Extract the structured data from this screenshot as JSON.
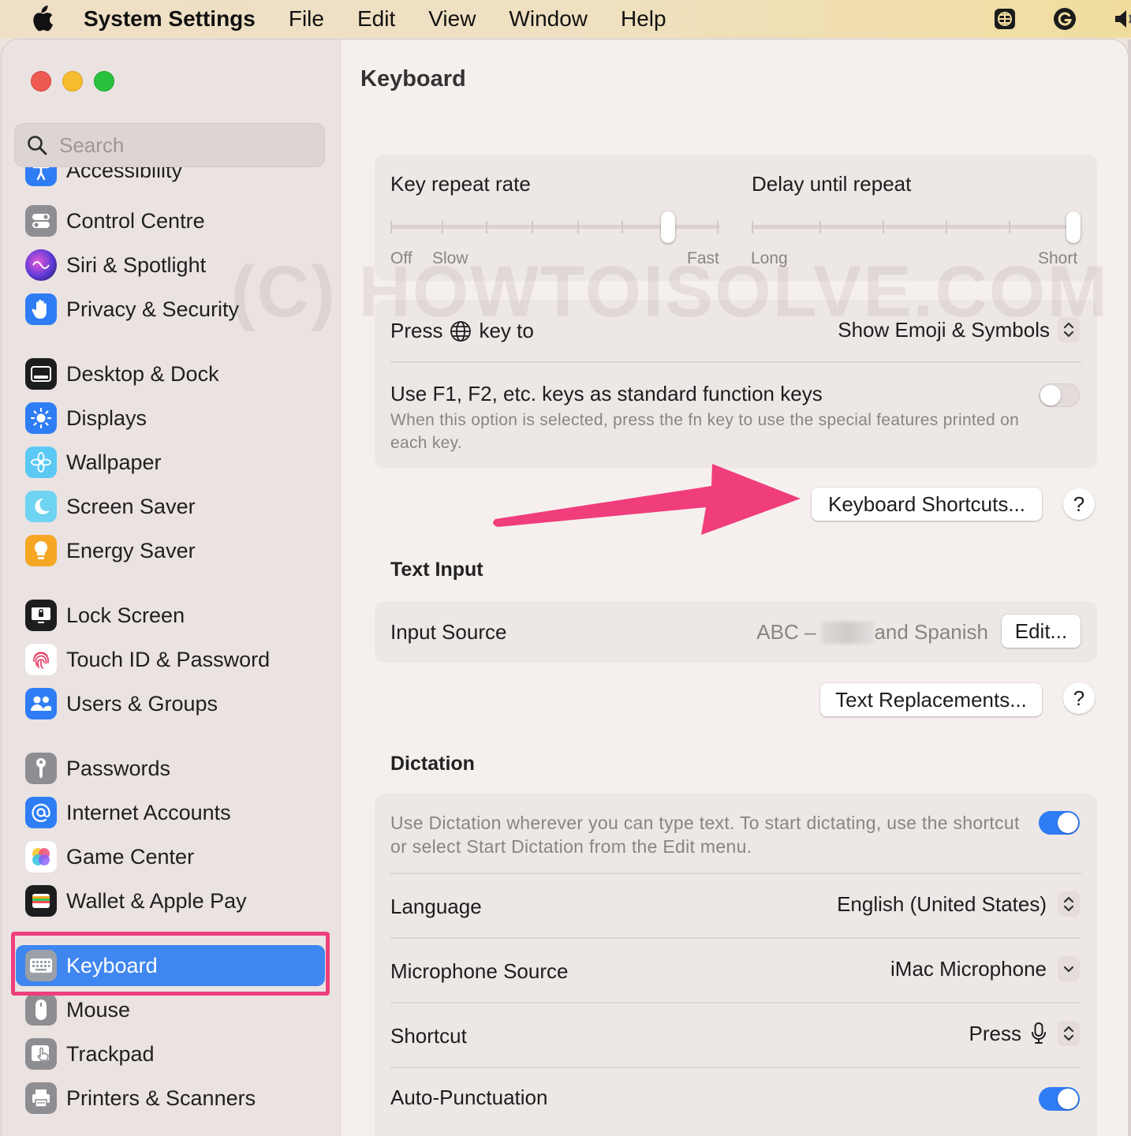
{
  "menubar": {
    "app_name": "System Settings",
    "items": [
      "File",
      "Edit",
      "View",
      "Window",
      "Help"
    ],
    "icons": [
      "apple-logo",
      "globe-grid-icon",
      "grammarly-icon",
      "speaker-icon"
    ]
  },
  "sidebar": {
    "search_placeholder": "Search",
    "partial_item": "Accessibility",
    "items": [
      {
        "label": "Control Centre",
        "icon": "control-centre-icon"
      },
      {
        "label": "Siri & Spotlight",
        "icon": "siri-icon"
      },
      {
        "label": "Privacy & Security",
        "icon": "hand-icon"
      },
      {
        "label": "Desktop & Dock",
        "icon": "dock-icon"
      },
      {
        "label": "Displays",
        "icon": "sun-icon"
      },
      {
        "label": "Wallpaper",
        "icon": "flower-icon"
      },
      {
        "label": "Screen Saver",
        "icon": "moon-icon"
      },
      {
        "label": "Energy Saver",
        "icon": "bulb-icon"
      },
      {
        "label": "Lock Screen",
        "icon": "lock-screen-icon"
      },
      {
        "label": "Touch ID & Password",
        "icon": "fingerprint-icon"
      },
      {
        "label": "Users & Groups",
        "icon": "users-icon"
      },
      {
        "label": "Passwords",
        "icon": "key-icon"
      },
      {
        "label": "Internet Accounts",
        "icon": "at-icon"
      },
      {
        "label": "Game Center",
        "icon": "game-center-icon"
      },
      {
        "label": "Wallet & Apple Pay",
        "icon": "wallet-icon"
      },
      {
        "label": "Keyboard",
        "icon": "keyboard-icon",
        "selected": true
      },
      {
        "label": "Mouse",
        "icon": "mouse-icon"
      },
      {
        "label": "Trackpad",
        "icon": "trackpad-icon"
      },
      {
        "label": "Printers & Scanners",
        "icon": "printer-icon"
      }
    ]
  },
  "main": {
    "title": "Keyboard",
    "watermark": "(C) HOWTOISOLVE.COM",
    "key_repeat": {
      "label": "Key repeat rate",
      "min_label": "Off",
      "slow_label": "Slow",
      "max_label": "Fast",
      "value_fraction": 0.86
    },
    "delay_repeat": {
      "label": "Delay until repeat",
      "min_label": "Long",
      "max_label": "Short",
      "value_fraction": 1.0
    },
    "press_key": {
      "label_prefix": "Press",
      "label_suffix": "key to",
      "value": "Show Emoji & Symbols"
    },
    "fn_keys": {
      "label": "Use F1, F2, etc. keys as standard function keys",
      "description": "When this option is selected, press the fn key to use the special features printed on each key.",
      "enabled": false
    },
    "keyboard_shortcuts_button": "Keyboard Shortcuts...",
    "help_label": "?",
    "text_input": {
      "title": "Text Input",
      "input_source_label": "Input Source",
      "input_source_prefix": "ABC –",
      "input_source_suffix": "and Spanish",
      "edit_button": "Edit...",
      "text_replacements_button": "Text Replacements..."
    },
    "dictation": {
      "title": "Dictation",
      "description": "Use Dictation wherever you can type text. To start dictating, use the shortcut or select Start Dictation from the Edit menu.",
      "enabled": true,
      "language_label": "Language",
      "language_value": "English (United States)",
      "microphone_label": "Microphone Source",
      "microphone_value": "iMac Microphone",
      "shortcut_label": "Shortcut",
      "shortcut_value": "Press",
      "auto_punct_label": "Auto-Punctuation",
      "auto_punct_enabled": true
    }
  },
  "colors": {
    "accent": "#2f7df5",
    "highlight": "#ee3f7d",
    "arrow": "#f03d7c"
  }
}
